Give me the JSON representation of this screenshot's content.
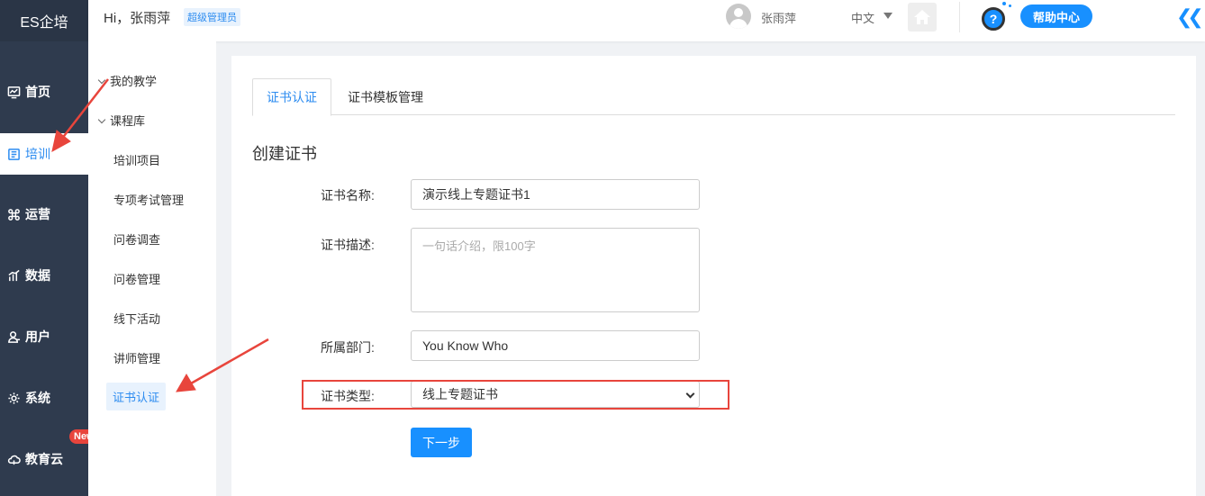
{
  "app": {
    "logo": "ES企培"
  },
  "header": {
    "greeting": "Hi，张雨萍",
    "role": "超级管理员",
    "user_name": "张雨萍",
    "language": "中文",
    "help_label": "帮助中心",
    "help_icon_text": "?"
  },
  "sidebar": {
    "items": [
      {
        "label": "首页",
        "icon": "dashboard-icon"
      },
      {
        "label": "培训",
        "icon": "book-icon",
        "active": true
      },
      {
        "label": "运营",
        "icon": "command-icon"
      },
      {
        "label": "数据",
        "icon": "chart-icon"
      },
      {
        "label": "用户",
        "icon": "user-icon"
      },
      {
        "label": "系统",
        "icon": "gear-icon"
      },
      {
        "label": "教育云",
        "icon": "cloud-icon",
        "badge": "New"
      }
    ]
  },
  "submenu": {
    "groups": [
      "我的教学",
      "课程库"
    ],
    "items": [
      "培训项目",
      "专项考试管理",
      "问卷调查",
      "问卷管理",
      "线下活动",
      "讲师管理",
      "证书认证"
    ],
    "active": "证书认证"
  },
  "main": {
    "tabs": [
      {
        "label": "证书认证",
        "active": true
      },
      {
        "label": "证书模板管理",
        "active": false
      }
    ],
    "section_title": "创建证书",
    "form": {
      "name_label": "证书名称:",
      "name_value": "演示线上专题证书1",
      "desc_label": "证书描述:",
      "desc_placeholder": "一句话介绍，限100字",
      "dept_label": "所属部门:",
      "dept_value": "You Know Who",
      "type_label": "证书类型:",
      "type_value": "线上专题证书",
      "submit_label": "下一步"
    }
  },
  "colors": {
    "accent": "#1890ff",
    "sidebar_bg": "#2f3b4e",
    "annotation": "#e8453c"
  }
}
